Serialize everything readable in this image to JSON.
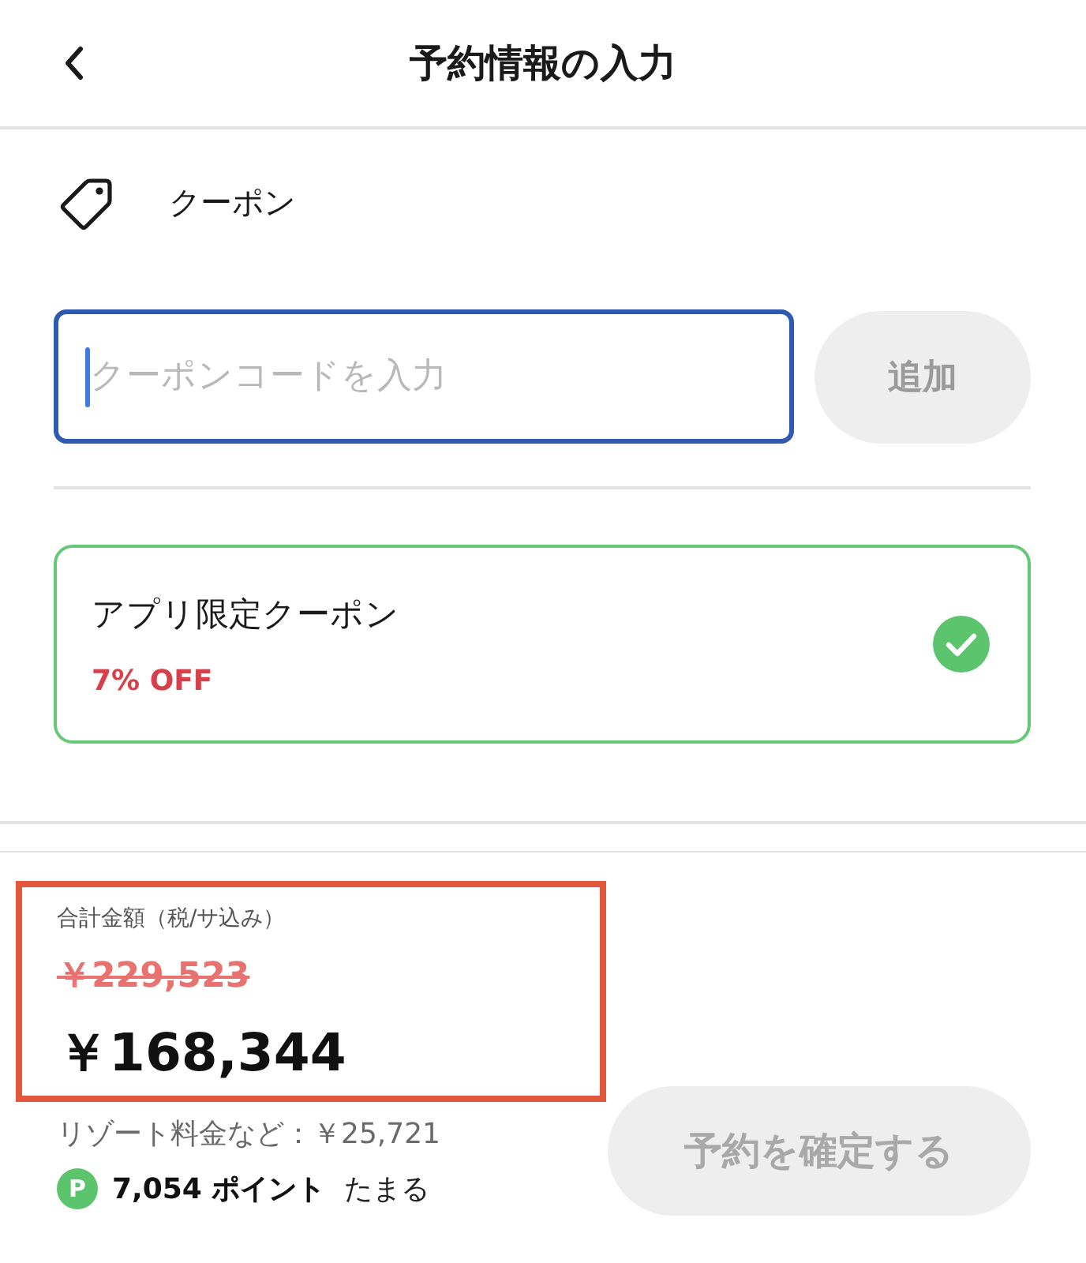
{
  "header": {
    "title": "予約情報の入力"
  },
  "coupon_section": {
    "label": "クーポン",
    "code_field": {
      "placeholder": "クーポンコードを入力",
      "focused": true
    },
    "add_button": {
      "label": "追加",
      "disabled": true
    },
    "coupons": [
      {
        "name": "アプリ限定クーポン",
        "discount": "7% OFF",
        "selected": true
      }
    ]
  },
  "footer": {
    "total": {
      "label": "合計金額（税/サ込み）",
      "original_price": "￥229,523",
      "price": "￥168,344",
      "highlighted": true
    },
    "resort_fee": "リゾート料金など：￥25,721",
    "points": {
      "badge": "P",
      "amount": "7,054 ポイント",
      "suffix": "たまる"
    },
    "confirm_button": {
      "label": "予約を確定する",
      "disabled": true
    }
  }
}
